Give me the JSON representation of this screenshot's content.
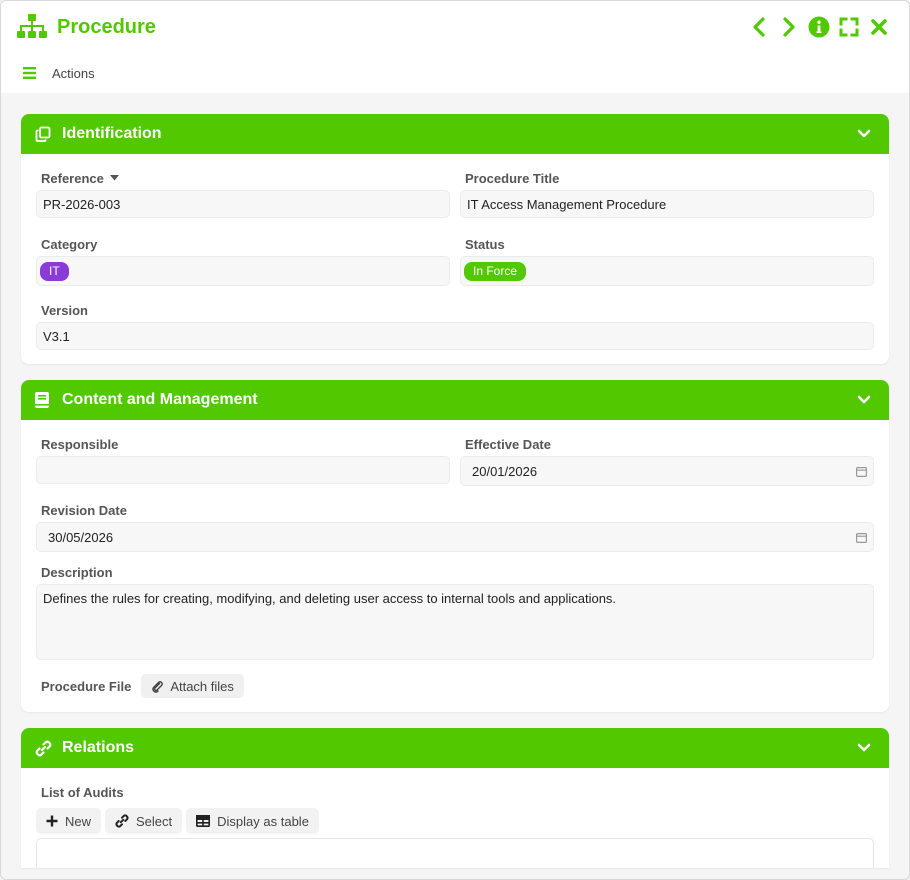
{
  "window": {
    "title": "Procedure",
    "actions_label": "Actions"
  },
  "colors": {
    "accent": "#52c800",
    "purple": "#8a3ad6"
  },
  "identification": {
    "title": "Identification",
    "reference_label": "Reference",
    "reference_value": "PR-2026-003",
    "title_label": "Procedure Title",
    "title_value": "IT Access Management Procedure",
    "category_label": "Category",
    "category_value": "IT",
    "status_label": "Status",
    "status_value": "In Force",
    "version_label": "Version",
    "version_value": "V3.1"
  },
  "content": {
    "title": "Content and Management",
    "responsible_label": "Responsible",
    "responsible_value": "",
    "effective_label": "Effective Date",
    "effective_value": "20/01/2026",
    "revision_label": "Revision Date",
    "revision_value": "30/05/2026",
    "description_label": "Description",
    "description_value": "Defines the rules for creating, modifying, and deleting user access to internal tools and applications.",
    "file_label": "Procedure File",
    "attach_label": "Attach files"
  },
  "relations": {
    "title": "Relations",
    "audits_label": "List of Audits",
    "new_label": "New",
    "select_label": "Select",
    "table_label": "Display as table"
  }
}
